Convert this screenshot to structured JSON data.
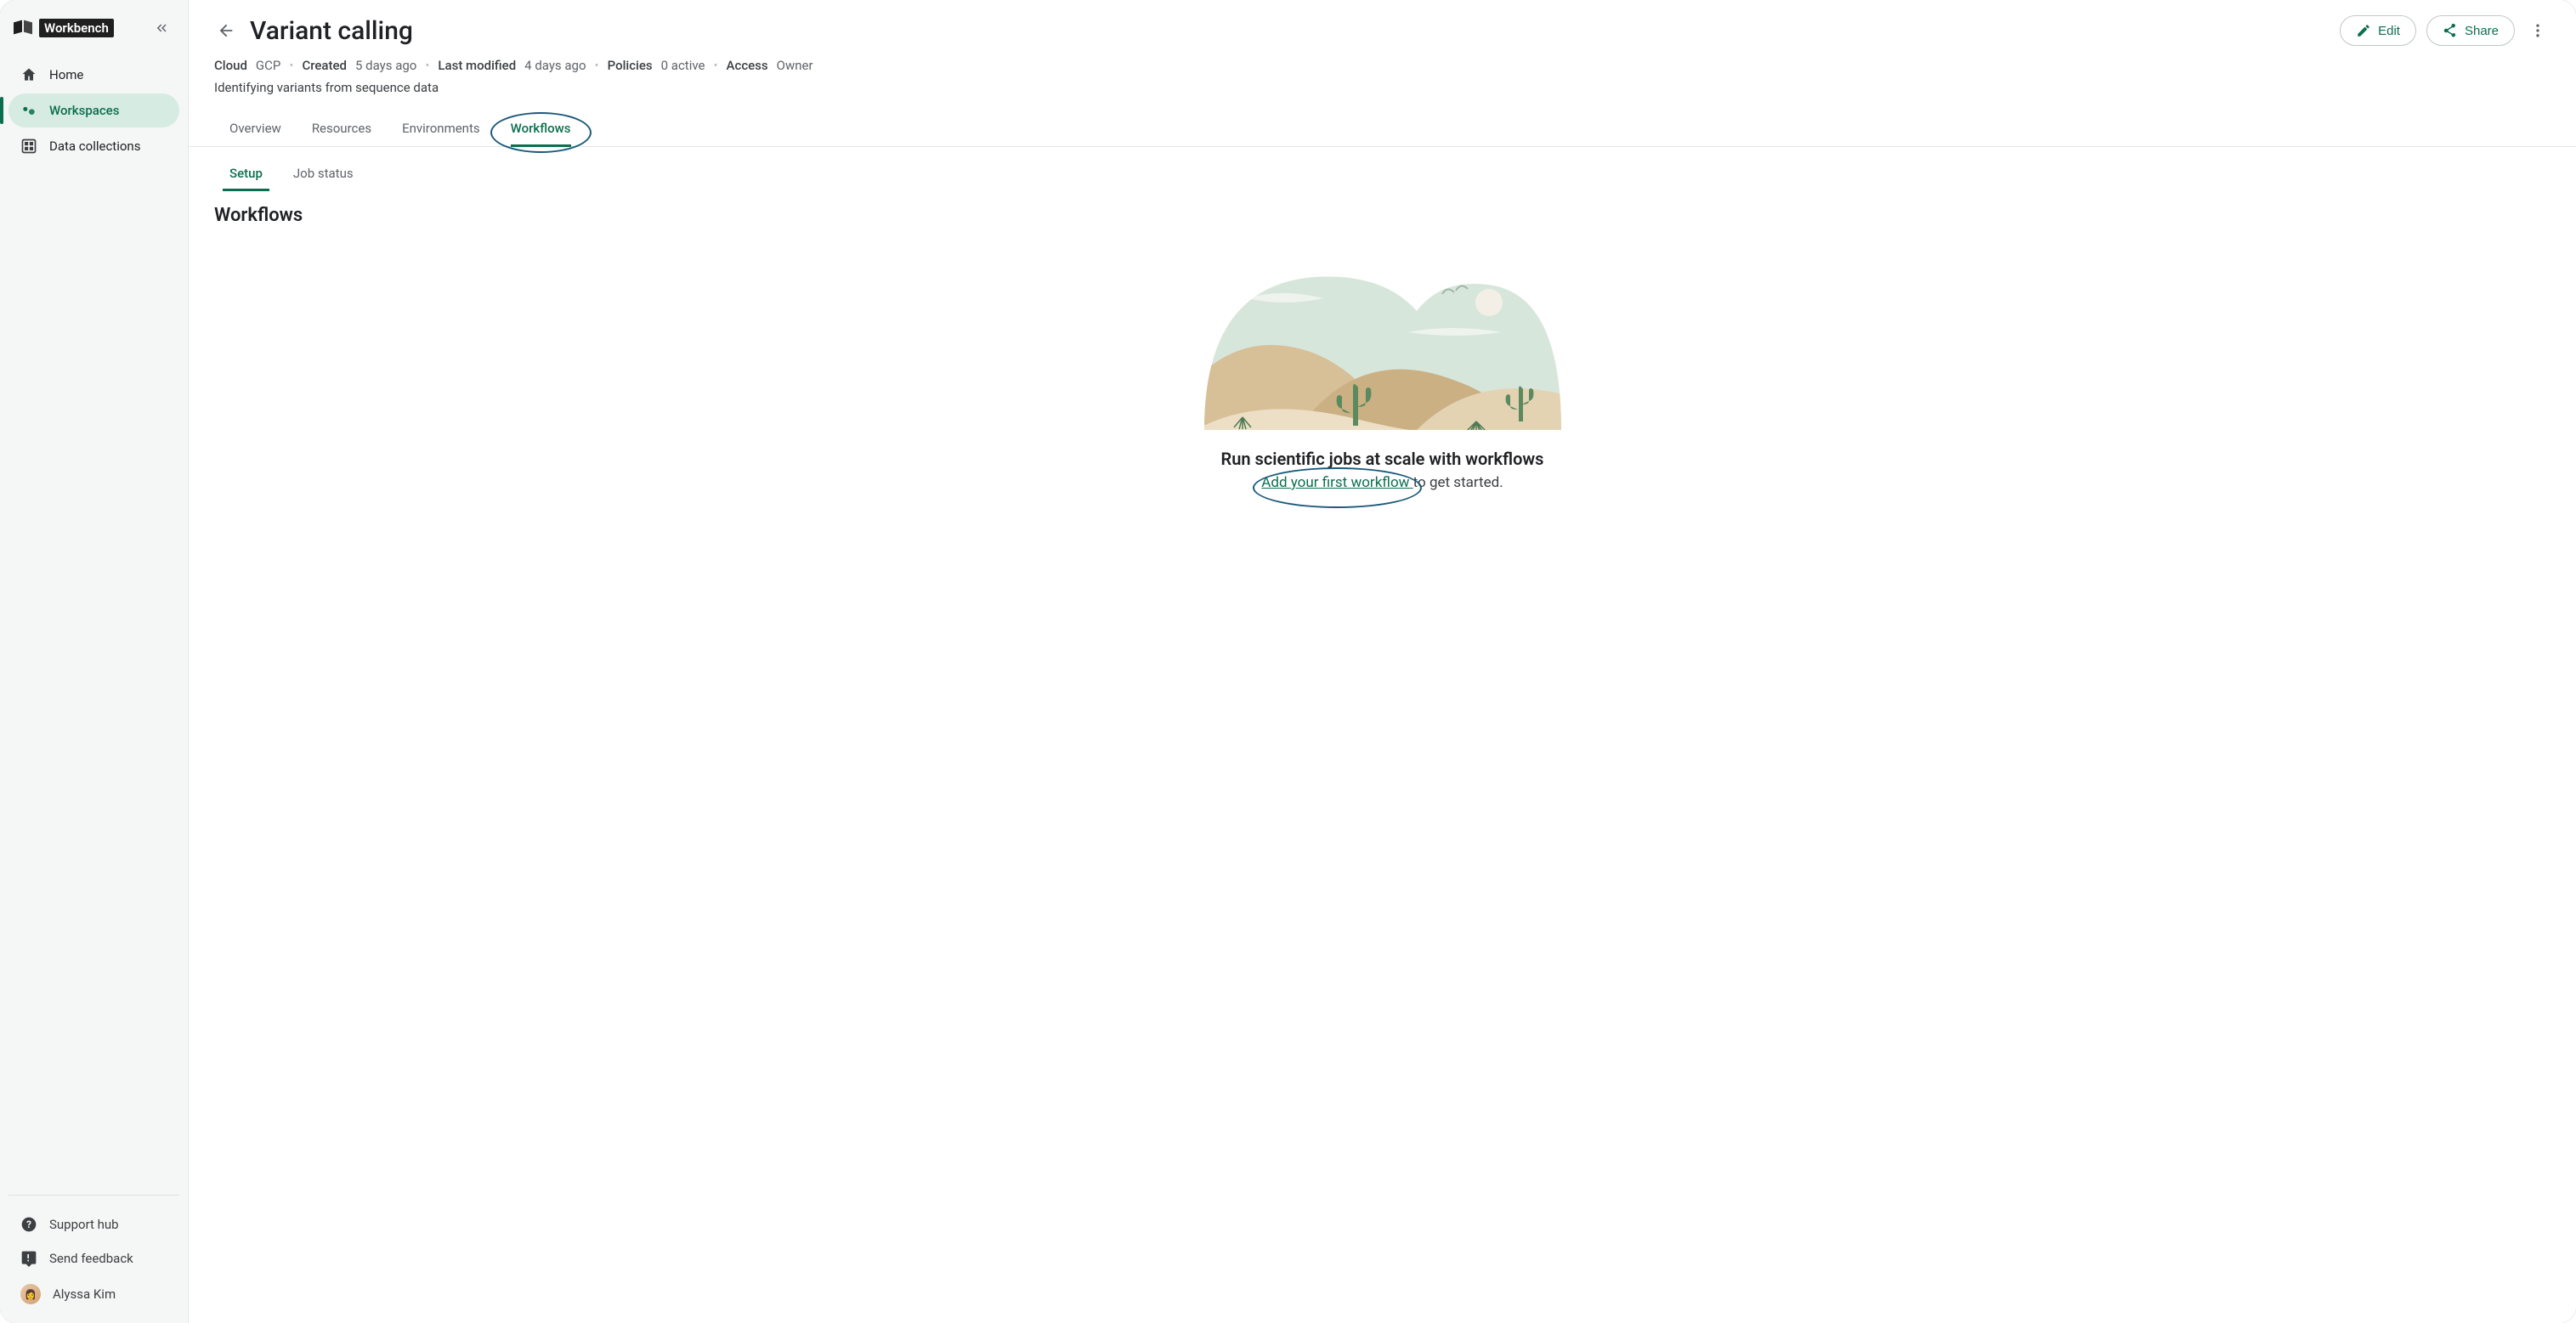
{
  "app": {
    "name": "Workbench"
  },
  "sidebar": {
    "items": [
      {
        "label": "Home"
      },
      {
        "label": "Workspaces"
      },
      {
        "label": "Data collections"
      }
    ],
    "footer": {
      "support": "Support hub",
      "feedback": "Send feedback",
      "user": "Alyssa Kim"
    }
  },
  "header": {
    "title": "Variant calling",
    "edit": "Edit",
    "share": "Share",
    "meta": {
      "cloud_label": "Cloud",
      "cloud_value": "GCP",
      "created_label": "Created",
      "created_value": "5 days ago",
      "modified_label": "Last modified",
      "modified_value": "4 days ago",
      "policies_label": "Policies",
      "policies_value": "0 active",
      "access_label": "Access",
      "access_value": "Owner"
    },
    "description": "Identifying variants from sequence data"
  },
  "tabs": [
    {
      "label": "Overview"
    },
    {
      "label": "Resources"
    },
    {
      "label": "Environments"
    },
    {
      "label": "Workflows"
    }
  ],
  "subtabs": [
    {
      "label": "Setup"
    },
    {
      "label": "Job status"
    }
  ],
  "content": {
    "section_title": "Workflows",
    "empty_title": "Run scientific jobs at scale with workflows",
    "empty_link": "Add your first workflow",
    "empty_suffix": " to get started."
  }
}
